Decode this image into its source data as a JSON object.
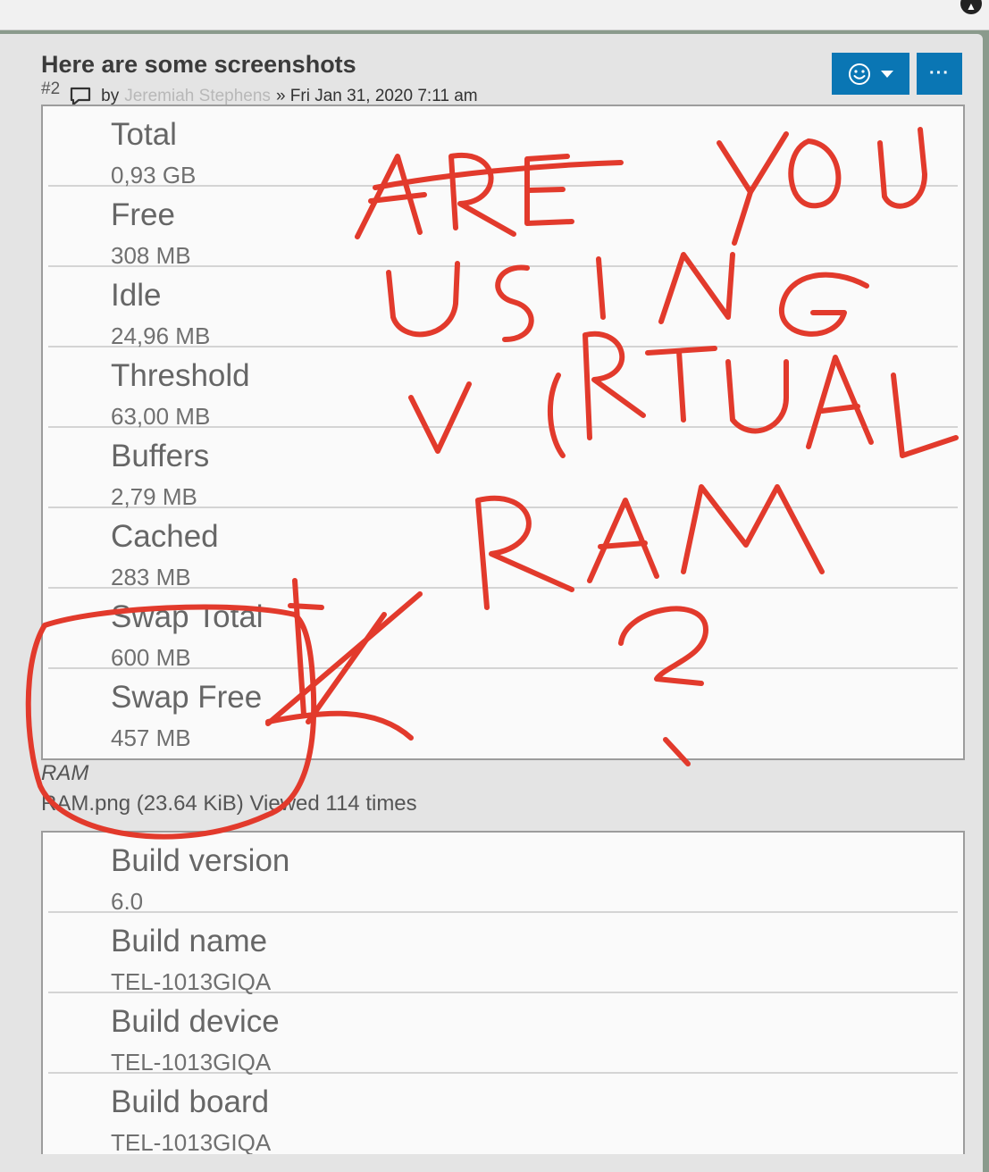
{
  "post": {
    "title": "Here are some screenshots",
    "number": "#2",
    "by": "by",
    "author": "Jeremiah Stephens",
    "date": "» Fri Jan 31, 2020 7:11 am",
    "reaction_icon": "smiley-icon",
    "more_label": "···"
  },
  "ram_screenshot": {
    "rows": [
      {
        "label": "Total",
        "value": "0,93 GB"
      },
      {
        "label": "Free",
        "value": "308 MB"
      },
      {
        "label": "Idle",
        "value": "24,96 MB"
      },
      {
        "label": "Threshold",
        "value": "63,00 MB"
      },
      {
        "label": "Buffers",
        "value": "2,79 MB"
      },
      {
        "label": "Cached",
        "value": "283 MB"
      },
      {
        "label": "Swap Total",
        "value": "600 MB"
      },
      {
        "label": "Swap Free",
        "value": "457 MB"
      }
    ],
    "caption_title": "RAM",
    "caption_info": "RAM.png (23.64 KiB) Viewed 114 times"
  },
  "build_screenshot": {
    "rows": [
      {
        "label": "Build version",
        "value": "6.0"
      },
      {
        "label": "Build name",
        "value": "TEL-1013GIQA"
      },
      {
        "label": "Build device",
        "value": "TEL-1013GIQA"
      },
      {
        "label": "Build board",
        "value": "TEL-1013GIQA"
      }
    ]
  },
  "annotation": {
    "handwritten_text": "ARE YOU USING VIRTUAL RAM ?",
    "color": "#e23a2c"
  }
}
